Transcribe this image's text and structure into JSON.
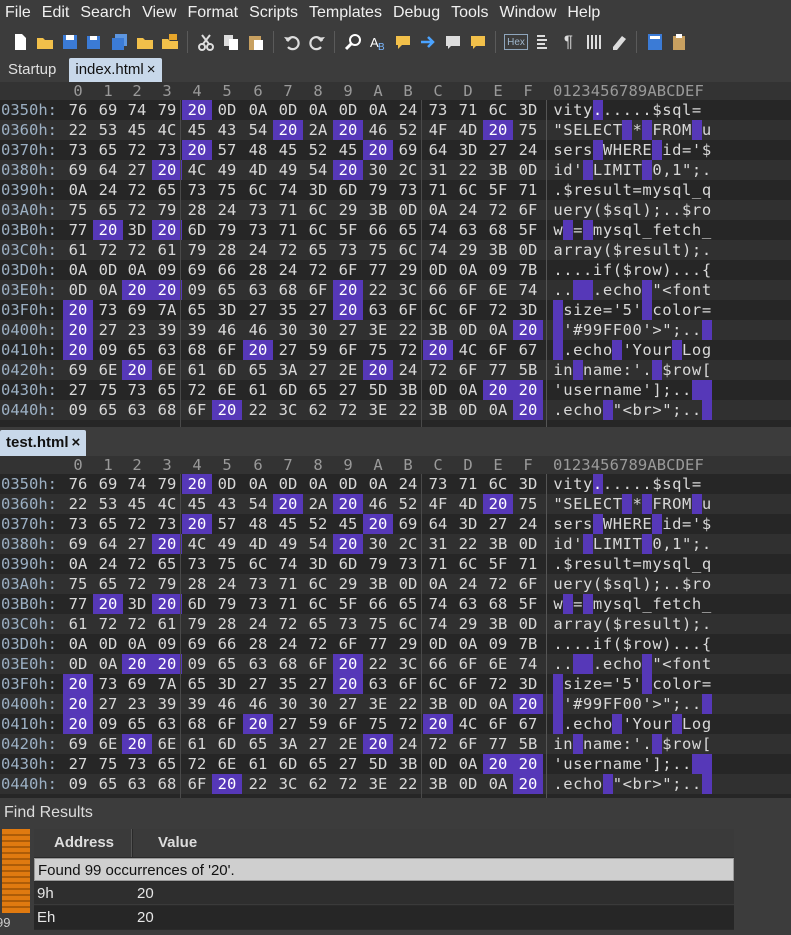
{
  "menu": [
    "File",
    "Edit",
    "Search",
    "View",
    "Format",
    "Scripts",
    "Templates",
    "Debug",
    "Tools",
    "Window",
    "Help"
  ],
  "toolbar_icons": [
    "new-file-icon",
    "open-folder-icon",
    "save-icon",
    "save-as-icon",
    "save-all-icon",
    "open-folder-2-icon",
    "open-project-icon",
    "cut-icon",
    "copy-icon",
    "paste-icon",
    "undo-icon",
    "redo-icon",
    "find-icon",
    "replace-icon",
    "find-in-files-icon",
    "goto-icon",
    "insert-icon",
    "overwrite-icon",
    "hex-mode-icon",
    "text-mode-icon",
    "pilcrow-icon",
    "columns-icon",
    "highlight-icon",
    "calculator-icon",
    "clipboard-icon"
  ],
  "toolbar_hex_label": "Hex",
  "toolbar_pilcrow": "¶",
  "tabs_top": [
    {
      "label": "Startup",
      "active": false,
      "close": ""
    },
    {
      "label": "index.html",
      "active": true,
      "close": "×"
    }
  ],
  "tab_bottom": {
    "label": "test.html",
    "close": "×"
  },
  "column_headers": [
    "0",
    "1",
    "2",
    "3",
    "4",
    "5",
    "6",
    "7",
    "8",
    "9",
    "A",
    "B",
    "C",
    "D",
    "E",
    "F"
  ],
  "ascii_header": "0123456789ABCDEF",
  "hex_rows": [
    {
      "addr": "0350h:",
      "bytes": [
        "76",
        "69",
        "74",
        "79",
        "20",
        "0D",
        "0A",
        "0D",
        "0A",
        "0D",
        "0A",
        "24",
        "73",
        "71",
        "6C",
        "3D"
      ],
      "text": "vity......$sql="
    },
    {
      "addr": "0360h:",
      "bytes": [
        "22",
        "53",
        "45",
        "4C",
        "45",
        "43",
        "54",
        "20",
        "2A",
        "20",
        "46",
        "52",
        "4F",
        "4D",
        "20",
        "75"
      ],
      "text": "\"SELECT * FROM u"
    },
    {
      "addr": "0370h:",
      "bytes": [
        "73",
        "65",
        "72",
        "73",
        "20",
        "57",
        "48",
        "45",
        "52",
        "45",
        "20",
        "69",
        "64",
        "3D",
        "27",
        "24"
      ],
      "text": "sers WHERE id='$"
    },
    {
      "addr": "0380h:",
      "bytes": [
        "69",
        "64",
        "27",
        "20",
        "4C",
        "49",
        "4D",
        "49",
        "54",
        "20",
        "30",
        "2C",
        "31",
        "22",
        "3B",
        "0D"
      ],
      "text": "id' LIMIT 0,1\";."
    },
    {
      "addr": "0390h:",
      "bytes": [
        "0A",
        "24",
        "72",
        "65",
        "73",
        "75",
        "6C",
        "74",
        "3D",
        "6D",
        "79",
        "73",
        "71",
        "6C",
        "5F",
        "71"
      ],
      "text": ".$result=mysql_q"
    },
    {
      "addr": "03A0h:",
      "bytes": [
        "75",
        "65",
        "72",
        "79",
        "28",
        "24",
        "73",
        "71",
        "6C",
        "29",
        "3B",
        "0D",
        "0A",
        "24",
        "72",
        "6F"
      ],
      "text": "uery($sql);..$ro"
    },
    {
      "addr": "03B0h:",
      "bytes": [
        "77",
        "20",
        "3D",
        "20",
        "6D",
        "79",
        "73",
        "71",
        "6C",
        "5F",
        "66",
        "65",
        "74",
        "63",
        "68",
        "5F"
      ],
      "text": "w = mysql_fetch_"
    },
    {
      "addr": "03C0h:",
      "bytes": [
        "61",
        "72",
        "72",
        "61",
        "79",
        "28",
        "24",
        "72",
        "65",
        "73",
        "75",
        "6C",
        "74",
        "29",
        "3B",
        "0D"
      ],
      "text": "array($result);."
    },
    {
      "addr": "03D0h:",
      "bytes": [
        "0A",
        "0D",
        "0A",
        "09",
        "69",
        "66",
        "28",
        "24",
        "72",
        "6F",
        "77",
        "29",
        "0D",
        "0A",
        "09",
        "7B"
      ],
      "text": "....if($row)...{"
    },
    {
      "addr": "03E0h:",
      "bytes": [
        "0D",
        "0A",
        "20",
        "20",
        "09",
        "65",
        "63",
        "68",
        "6F",
        "20",
        "22",
        "3C",
        "66",
        "6F",
        "6E",
        "74"
      ],
      "text": "..  .echo \"<font"
    },
    {
      "addr": "03F0h:",
      "bytes": [
        "20",
        "73",
        "69",
        "7A",
        "65",
        "3D",
        "27",
        "35",
        "27",
        "20",
        "63",
        "6F",
        "6C",
        "6F",
        "72",
        "3D"
      ],
      "text": " size='5' color="
    },
    {
      "addr": "0400h:",
      "bytes": [
        "20",
        "27",
        "23",
        "39",
        "39",
        "46",
        "46",
        "30",
        "30",
        "27",
        "3E",
        "22",
        "3B",
        "0D",
        "0A",
        "20"
      ],
      "text": " '#99FF00'>\";.. "
    },
    {
      "addr": "0410h:",
      "bytes": [
        "20",
        "09",
        "65",
        "63",
        "68",
        "6F",
        "20",
        "27",
        "59",
        "6F",
        "75",
        "72",
        "20",
        "4C",
        "6F",
        "67"
      ],
      "text": " .echo 'Your Log"
    },
    {
      "addr": "0420h:",
      "bytes": [
        "69",
        "6E",
        "20",
        "6E",
        "61",
        "6D",
        "65",
        "3A",
        "27",
        "2E",
        "20",
        "24",
        "72",
        "6F",
        "77",
        "5B"
      ],
      "text": "in name:'. $row["
    },
    {
      "addr": "0430h:",
      "bytes": [
        "27",
        "75",
        "73",
        "65",
        "72",
        "6E",
        "61",
        "6D",
        "65",
        "27",
        "5D",
        "3B",
        "0D",
        "0A",
        "20",
        "20"
      ],
      "text": "'username'];..  "
    },
    {
      "addr": "0440h:",
      "bytes": [
        "09",
        "65",
        "63",
        "68",
        "6F",
        "20",
        "22",
        "3C",
        "62",
        "72",
        "3E",
        "22",
        "3B",
        "0D",
        "0A",
        "20"
      ],
      "text": ".echo \"<br>\";.. "
    }
  ],
  "highlight_byte": "20",
  "find_panel": {
    "title": "Find Results",
    "columns": [
      "Address",
      "Value"
    ],
    "summary": "Found 99 occurrences of '20'.",
    "count_label": "99",
    "rows": [
      {
        "address": "9h",
        "value": "20"
      },
      {
        "address": "Eh",
        "value": "20"
      }
    ]
  }
}
